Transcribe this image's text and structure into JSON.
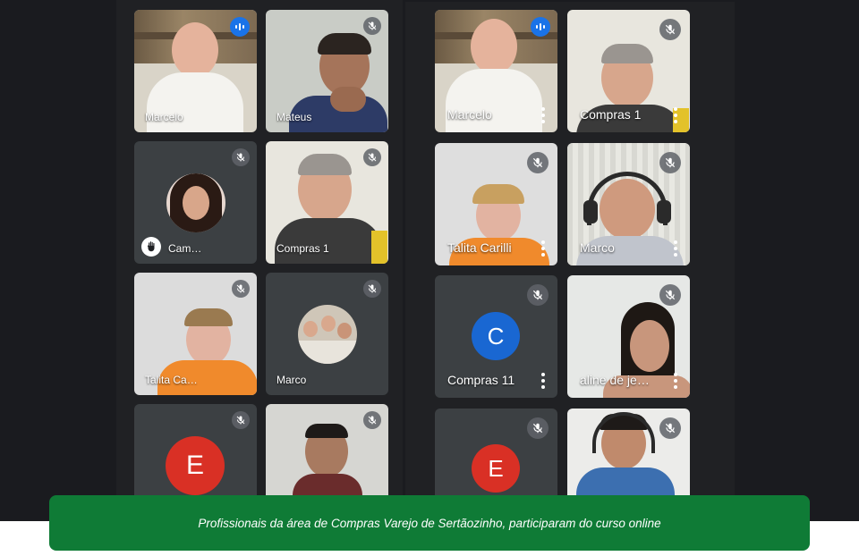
{
  "left_grid": {
    "tiles": [
      {
        "name": "Marcelo"
      },
      {
        "name": "Mateus"
      },
      {
        "name": "Cam…"
      },
      {
        "name": "Compras 1"
      },
      {
        "name": "Talita Ca…"
      },
      {
        "name": "Marco"
      },
      {
        "avatar_letter": "E"
      },
      {
        "name": ""
      }
    ]
  },
  "right_grid": {
    "tiles": [
      {
        "name": "Marcelo"
      },
      {
        "name": "Compras 1"
      },
      {
        "name": "Talita Carilli"
      },
      {
        "name": "Marco"
      },
      {
        "name": "Compras 11",
        "avatar_letter": "C"
      },
      {
        "name": "aline de je…"
      },
      {
        "avatar_letter": "E"
      },
      {
        "name": ""
      }
    ]
  },
  "colors": {
    "avatar_blue": "#1967d2",
    "avatar_red": "#d93025",
    "caption_green": "#0f7b36",
    "speaking_blue": "#1a73e8"
  },
  "icons": [
    "mic-off-icon",
    "speaking-indicator-icon",
    "more-options-icon",
    "raised-hand-icon"
  ],
  "caption": {
    "text": "Profissionais da área de Compras Varejo de Sertãozinho, participaram do curso online"
  }
}
